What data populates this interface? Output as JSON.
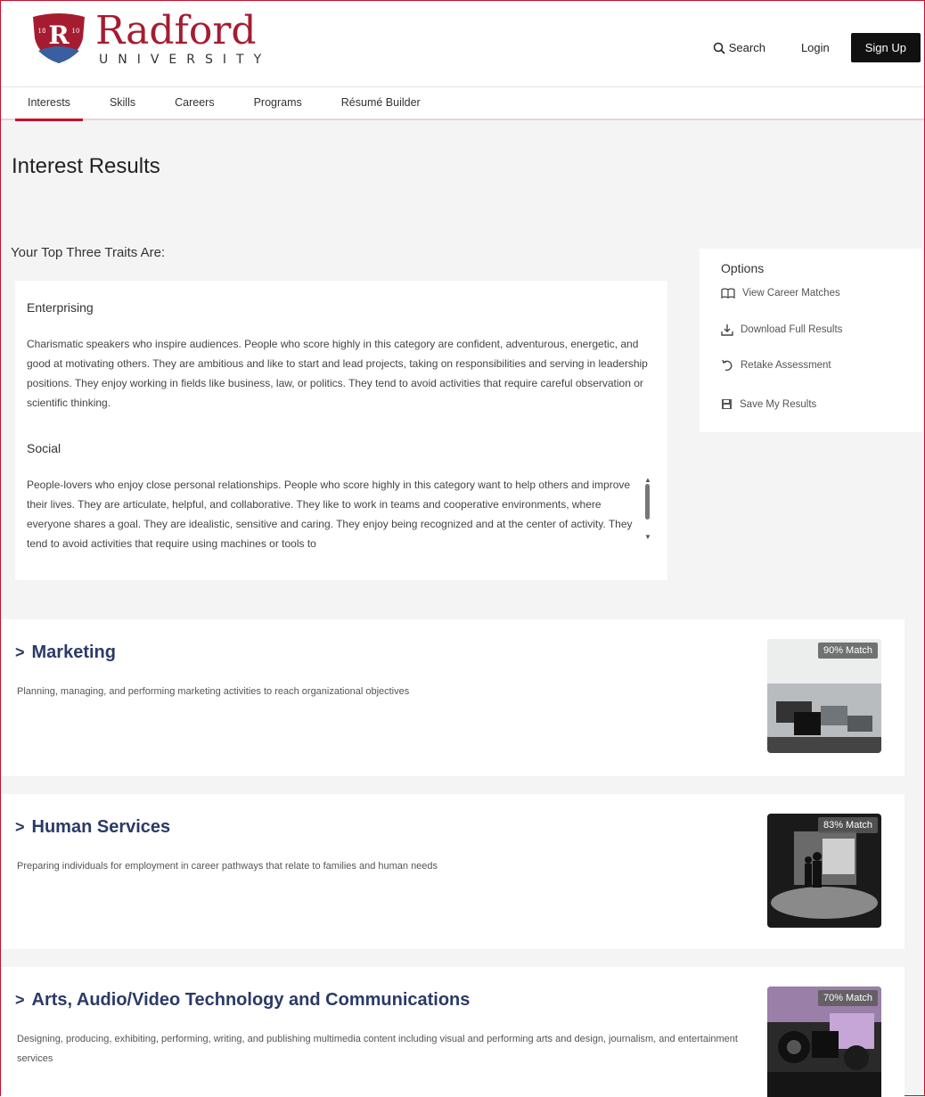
{
  "brand": {
    "name": "Radford",
    "sub": "UNIVERSITY",
    "color": "#a51c30"
  },
  "header": {
    "search_label": "Search",
    "login_label": "Login",
    "signup_label": "Sign Up"
  },
  "nav": [
    "Interests",
    "Skills",
    "Careers",
    "Programs",
    "Résumé Builder"
  ],
  "page_title": "Interest Results",
  "traits_heading": "Your Top Three Traits Are:",
  "traits": [
    {
      "name": "Enterprising",
      "description": "Charismatic speakers who inspire audiences. People who score highly in this category are confident, adventurous, energetic, and good at motivating others. They are ambitious and like to start and lead projects, taking on responsibilities and serving in leadership positions. They enjoy working in fields like business, law, or politics. They tend to avoid activities that require careful observation or scientific thinking."
    },
    {
      "name": "Social",
      "description": "People-lovers who enjoy close personal relationships. People who score highly in this category want to help others and improve their lives. They are articulate, helpful, and collaborative. They like to work in teams and cooperative environments, where everyone shares a goal. They are idealistic, sensitive and caring. They enjoy being recognized and at the center of activity. They tend to avoid activities that require using machines or tools to"
    }
  ],
  "options": {
    "title": "Options",
    "items": [
      "View Career Matches",
      "Download Full Results",
      "Retake Assessment",
      "Save My Results"
    ]
  },
  "clusters": [
    {
      "title": "Marketing",
      "description": "Planning, managing, and performing marketing activities to reach organizational objectives",
      "match": "90% Match"
    },
    {
      "title": "Human Services",
      "description": "Preparing individuals for employment in career pathways that relate to families and human needs",
      "match": "83% Match"
    },
    {
      "title": "Arts, Audio/Video Technology and Communications",
      "description": "Designing, producing, exhibiting, performing, writing, and publishing multimedia content including visual and performing arts and design, journalism, and entertainment services",
      "match": "70% Match"
    }
  ]
}
